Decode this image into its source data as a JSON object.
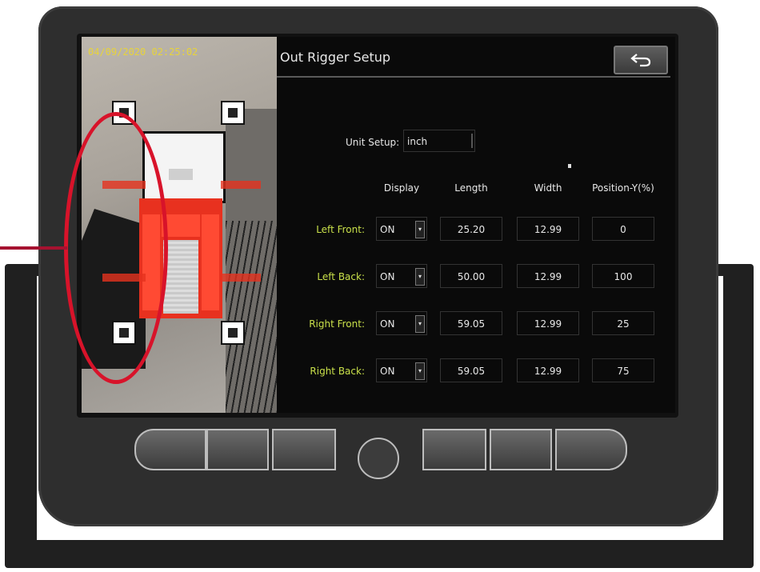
{
  "camera": {
    "timestamp": "04/09/2020 02:25:02"
  },
  "screen": {
    "title": "Out Rigger Setup",
    "back_icon": "back-arrow-icon"
  },
  "unit_setup": {
    "label": "Unit Setup:",
    "value": "inch"
  },
  "table": {
    "headers": [
      "Display",
      "Length",
      "Width",
      "Position-Y(%)"
    ],
    "rows": [
      {
        "label": "Left Front:",
        "display": "ON",
        "length": "25.20",
        "width": "12.99",
        "position": "0"
      },
      {
        "label": "Left Back:",
        "display": "ON",
        "length": "50.00",
        "width": "12.99",
        "position": "100"
      },
      {
        "label": "Right Front:",
        "display": "ON",
        "length": "59.05",
        "width": "12.99",
        "position": "25"
      },
      {
        "label": "Right Back:",
        "display": "ON",
        "length": "59.05",
        "width": "12.99",
        "position": "75"
      }
    ]
  },
  "colors": {
    "highlight": "#d8132a",
    "row_label": "#c9e04a",
    "timestamp": "#e8d43a"
  }
}
